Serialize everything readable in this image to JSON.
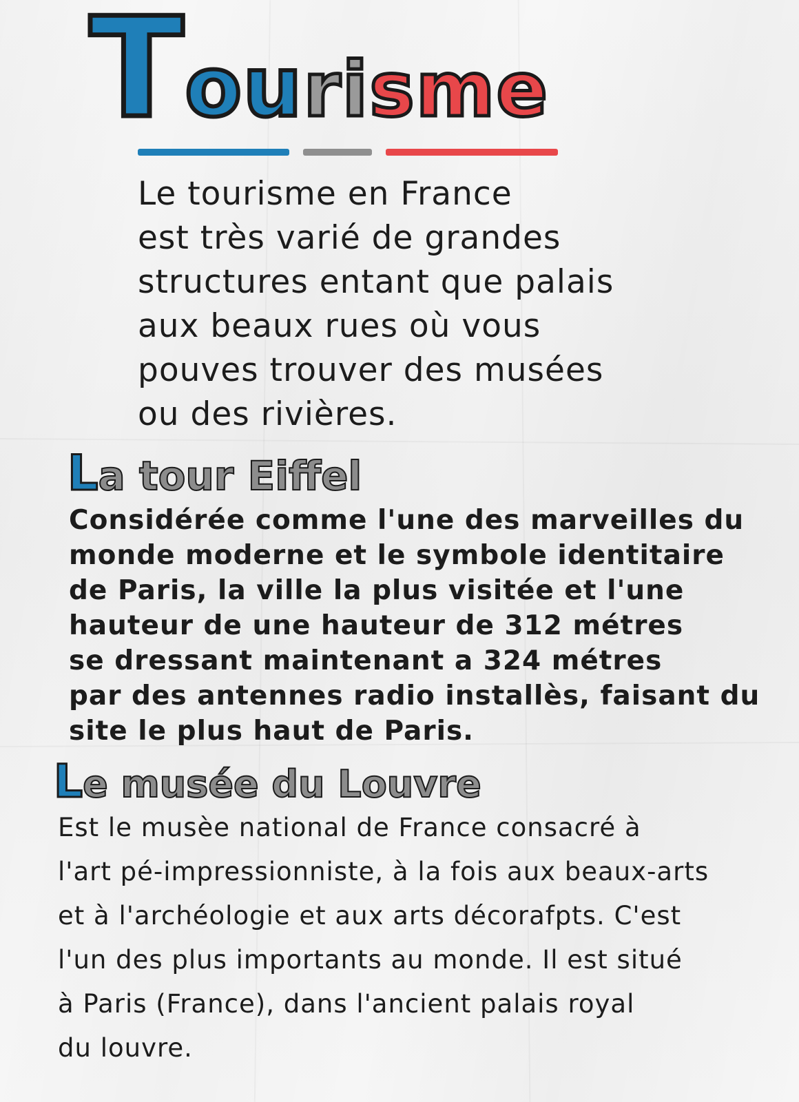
{
  "title": {
    "first_letter": "T",
    "blue_part": "ou",
    "gray_part": "ri",
    "red_part": "sme"
  },
  "intro": {
    "lines": [
      "Le tourisme en France",
      "est très varié de grandes",
      "structures entant que palais",
      "aux beaux rues où vous",
      "pouves trouver des musées",
      "ou des rivières."
    ]
  },
  "section_eiffel": {
    "heading_first": "L",
    "heading_rest": "a tour Eiffel",
    "lines": [
      "Considérée comme l'une des marveilles du",
      "monde moderne et le symbole identitaire",
      "de Paris, la ville la plus visitée et l'une",
      "hauteur de une hauteur de 312 métres",
      "se dressant maintenant a 324 métres",
      "par des antennes radio installès, faisant du",
      "site le plus haut de Paris."
    ]
  },
  "section_louvre": {
    "heading_first": "L",
    "heading_rest": "e musée du Louvre",
    "lines": [
      "Est le musèe national de France consacré à",
      "l'art pé-impressionniste, à la fois aux beaux-arts",
      "et à l'archéologie et aux arts décorafpts. C'est",
      "l'un des plus importants au monde. Il est situé",
      "à Paris (France), dans l'ancient palais royal",
      "du louvre."
    ]
  },
  "colors": {
    "blue": "#1f7fb8",
    "gray": "#9a9a9a",
    "red": "#e8474a",
    "ink": "#1c1c1c",
    "paper": "#f3f3f3"
  }
}
